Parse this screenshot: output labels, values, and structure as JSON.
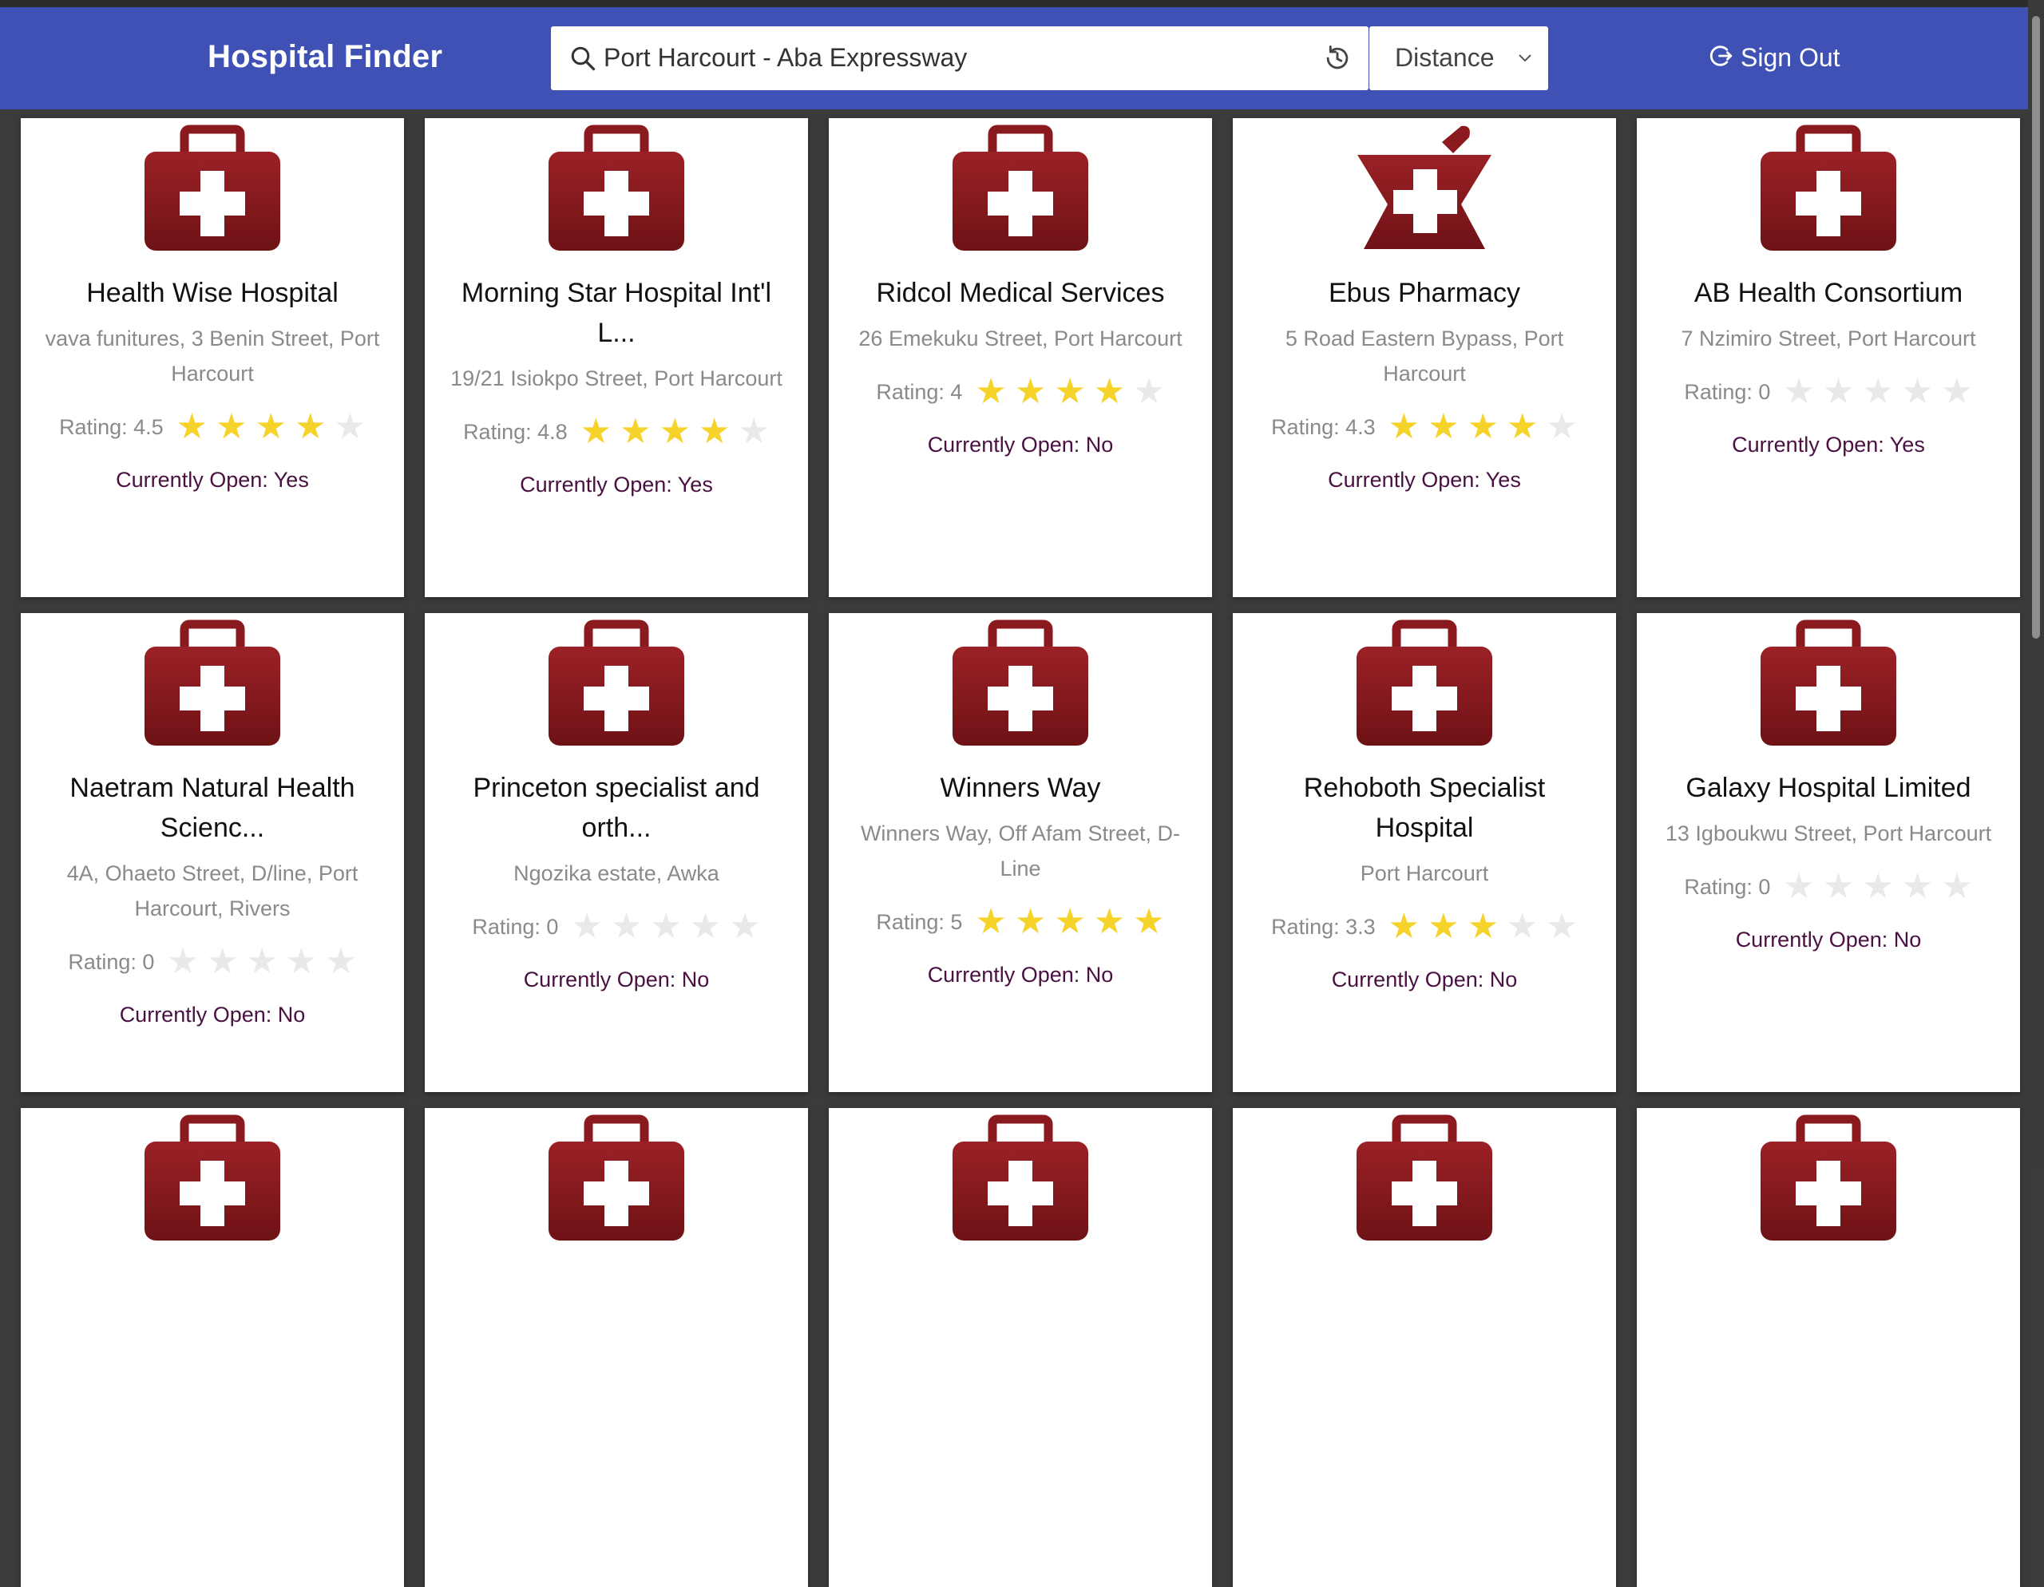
{
  "app": {
    "title": "Hospital Finder"
  },
  "search": {
    "query": "Port Harcourt - Aba Expressway"
  },
  "sort": {
    "selected": "Distance"
  },
  "account": {
    "signout_label": "Sign Out"
  },
  "colors": {
    "navbar": "#3f51b5",
    "icon_red": "#8a1a1e",
    "star_on": "#f6d32b",
    "star_off": "#e9e9e9",
    "open_text": "#4a1042"
  },
  "cards": [
    {
      "name": "Health Wise Hospital",
      "address": "vava funitures, 3 Benin Street, Port Harcourt",
      "rating_label": "Rating: 4.5",
      "rating": 4.5,
      "stars_filled": 4,
      "open_label": "Currently Open: Yes",
      "icon": "medical-kit-icon"
    },
    {
      "name": "Morning Star Hospital Int'l L...",
      "address": "19/21 Isiokpo Street, Port Harcourt",
      "rating_label": "Rating: 4.8",
      "rating": 4.8,
      "stars_filled": 4,
      "open_label": "Currently Open: Yes",
      "icon": "medical-kit-icon"
    },
    {
      "name": "Ridcol Medical Services",
      "address": "26 Emekuku Street, Port Harcourt",
      "rating_label": "Rating: 4",
      "rating": 4,
      "stars_filled": 4,
      "open_label": "Currently Open: No",
      "icon": "medical-kit-icon"
    },
    {
      "name": "Ebus Pharmacy",
      "address": "5 Road Eastern Bypass, Port Harcourt",
      "rating_label": "Rating: 4.3",
      "rating": 4.3,
      "stars_filled": 4,
      "open_label": "Currently Open: Yes",
      "icon": "pharmacy-mortar-icon"
    },
    {
      "name": "AB Health Consortium",
      "address": "7 Nzimiro Street, Port Harcourt",
      "rating_label": "Rating: 0",
      "rating": 0,
      "stars_filled": 0,
      "open_label": "Currently Open: Yes",
      "icon": "medical-kit-icon"
    },
    {
      "name": "Naetram Natural Health Scienc...",
      "address": "4A, Ohaeto Street, D/line, Port Harcourt, Rivers",
      "rating_label": "Rating: 0",
      "rating": 0,
      "stars_filled": 0,
      "open_label": "Currently Open: No",
      "icon": "medical-kit-icon"
    },
    {
      "name": "Princeton specialist and orth...",
      "address": "Ngozika estate, Awka",
      "rating_label": "Rating: 0",
      "rating": 0,
      "stars_filled": 0,
      "open_label": "Currently Open: No",
      "icon": "medical-kit-icon"
    },
    {
      "name": "Winners Way",
      "address": "Winners Way, Off Afam Street, D-Line",
      "rating_label": "Rating: 5",
      "rating": 5,
      "stars_filled": 5,
      "open_label": "Currently Open: No",
      "icon": "medical-kit-icon"
    },
    {
      "name": "Rehoboth Specialist Hospital",
      "address": "Port Harcourt",
      "rating_label": "Rating: 3.3",
      "rating": 3.3,
      "stars_filled": 3,
      "open_label": "Currently Open: No",
      "icon": "medical-kit-icon"
    },
    {
      "name": "Galaxy Hospital Limited",
      "address": "13 Igboukwu Street, Port Harcourt",
      "rating_label": "Rating: 0",
      "rating": 0,
      "stars_filled": 0,
      "open_label": "Currently Open: No",
      "icon": "medical-kit-icon"
    },
    {
      "name": "",
      "address": "",
      "rating_label": "",
      "stars_filled": 0,
      "open_label": "",
      "icon": "medical-kit-icon"
    },
    {
      "name": "",
      "address": "",
      "rating_label": "",
      "stars_filled": 0,
      "open_label": "",
      "icon": "medical-kit-icon"
    },
    {
      "name": "",
      "address": "",
      "rating_label": "",
      "stars_filled": 0,
      "open_label": "",
      "icon": "medical-kit-icon"
    },
    {
      "name": "",
      "address": "",
      "rating_label": "",
      "stars_filled": 0,
      "open_label": "",
      "icon": "medical-kit-icon"
    },
    {
      "name": "",
      "address": "",
      "rating_label": "",
      "stars_filled": 0,
      "open_label": "",
      "icon": "medical-kit-icon"
    }
  ]
}
